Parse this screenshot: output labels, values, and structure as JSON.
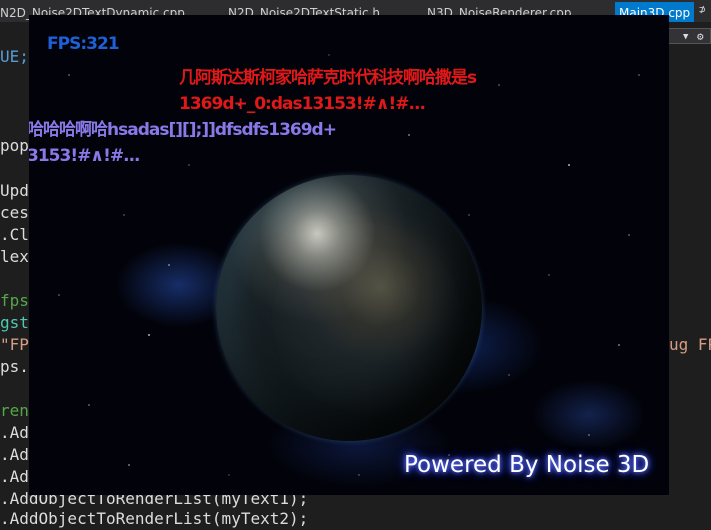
{
  "tabs": [
    {
      "label": "N2D_Noise2DTextDynamic.cpp",
      "active": false
    },
    {
      "label": "N2D_Noise2DTextStatic.h",
      "active": false
    },
    {
      "label": "N3D_NoiseRenderer.cpp",
      "active": false
    },
    {
      "label": "Main3D.cpp",
      "active": true
    }
  ],
  "tab_close_glyph": "⊅",
  "icons": {
    "dropdown": "chevron-down-icon",
    "settings": "gear-icon"
  },
  "code_lines": [
    {
      "text": "UE;",
      "color": "blue"
    },
    {
      "text": "pop(",
      "color": "white"
    },
    {
      "text": "Upda",
      "color": "white"
    },
    {
      "text": "cess",
      "color": "white"
    },
    {
      "text": ".Clea",
      "color": "white"
    },
    {
      "text": "lextT",
      "color": "white"
    },
    {
      "text": "fps",
      "color": "green"
    },
    {
      "text": "gstre",
      "color": "teal"
    },
    {
      "text": "\"FPS",
      "color": "orange"
    },
    {
      "text": "ps.S",
      "color": "white"
    },
    {
      "text": "renc",
      "color": "green"
    },
    {
      "text": ".Add",
      "color": "white"
    },
    {
      "text": ".Add",
      "color": "white"
    },
    {
      "text": ".Add",
      "color": "white"
    },
    {
      "text": ".AddObjectToRenderList(myText1);",
      "color": "white"
    },
    {
      "text": ".AddObjectToRenderList(myText2);",
      "color": "white"
    }
  ],
  "right_code": "ug FPS",
  "render": {
    "fps": "FPS:321",
    "red_line1": "几阿斯达斯柯家哈萨克时代科技啊哈撒是s",
    "red_line2": "1369d+_0:das13153!#∧!#...",
    "purple_line1": "哈哈哈啊哈hsadas[][];]]dfsdfs1369d+",
    "purple_line2": "3153!#∧!#...",
    "powered": "Powered By Noise 3D",
    "colors": {
      "fps": "#1f5fd8",
      "red": "#e01818",
      "purple": "#8a78e8",
      "glow": "#3e55ff"
    }
  }
}
